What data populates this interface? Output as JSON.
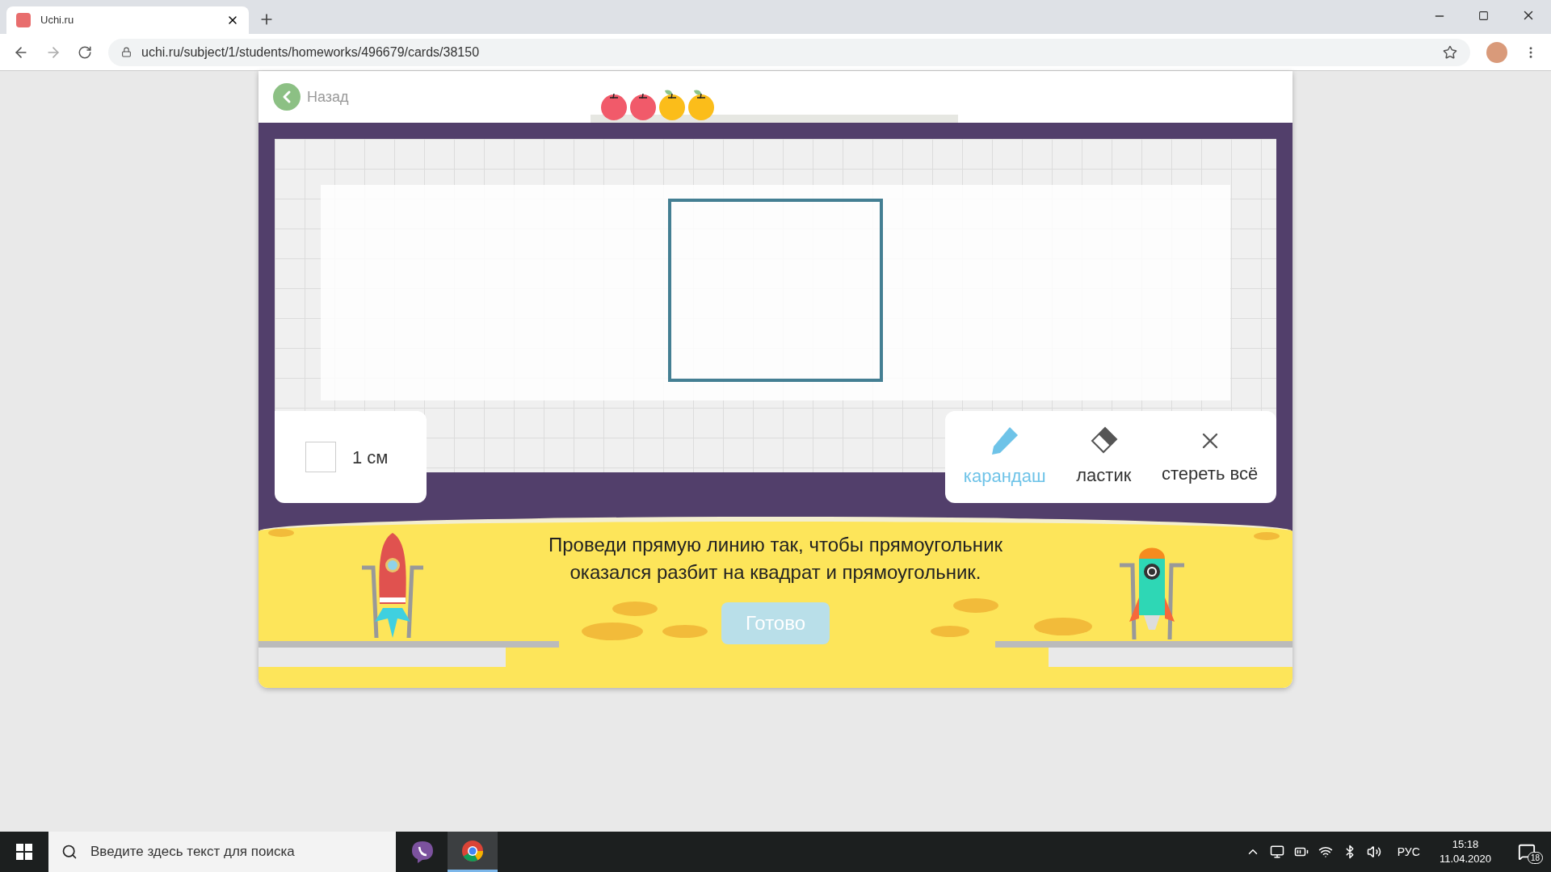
{
  "browser": {
    "tab": {
      "title": "Uchi.ru"
    },
    "url": "uchi.ru/subject/1/students/homeworks/496679/cards/38150"
  },
  "header": {
    "back_label": "Назад",
    "progress": [
      {
        "kind": "red"
      },
      {
        "kind": "red"
      },
      {
        "kind": "yellow"
      },
      {
        "kind": "yellow"
      }
    ]
  },
  "unit": {
    "label": "1 см",
    "checked": false
  },
  "tools": [
    {
      "label": "карандаш",
      "kind": "pencil",
      "selected": true
    },
    {
      "label": "ластик",
      "kind": "eraser",
      "selected": false
    },
    {
      "label": "стереть всё",
      "kind": "clear",
      "selected": false
    }
  ],
  "task": {
    "text": "Проведи прямую линию так, чтобы прямоугольник оказался разбит на квадрат и прямоугольник.",
    "button": "Готово",
    "disabled": true
  },
  "taskbar": {
    "search_placeholder": "Введите здесь текст для поиска",
    "apps": [
      {
        "kind": "viber",
        "selected": false
      },
      {
        "kind": "chrome",
        "selected": true
      }
    ],
    "language": "РУС",
    "time": "15:18",
    "date": "11.04.2020",
    "notifications": "18"
  }
}
